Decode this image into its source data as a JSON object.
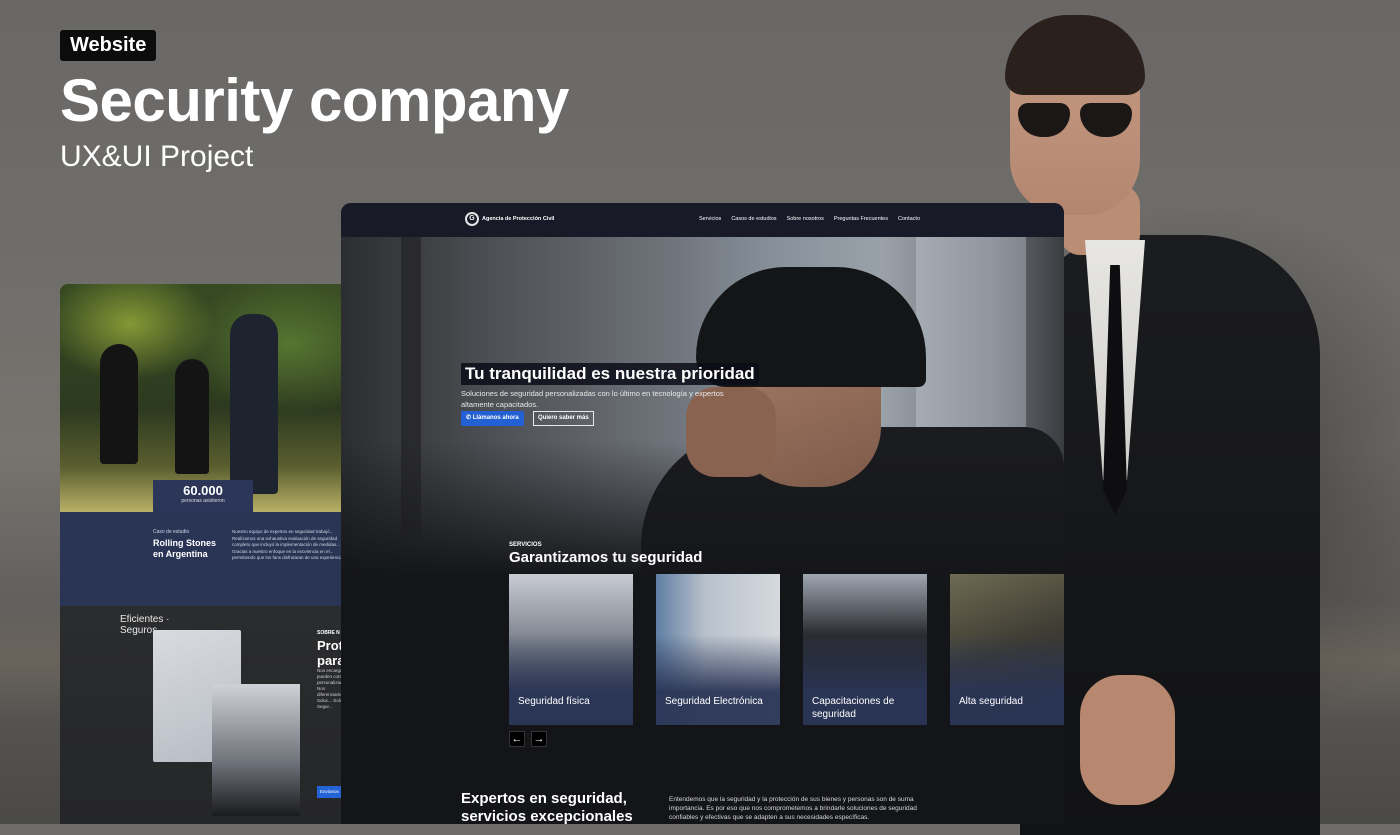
{
  "header": {
    "tag": "Website",
    "title": "Security company",
    "subtitle": "UX&UI Project"
  },
  "left_mockup": {
    "stat_number": "60.000",
    "stat_label": "personas asistieron",
    "case_small": "Caso de estudio",
    "case_title": "Rolling Stones en Argentina",
    "case_text": "Nuestro equipo de expertos en seguridad trabajó... Realizamos una exhaustiva evaluación de seguridad completo que incluyó la implementación de medidas... Gracias a nuestro enfoque en la excelencia en el... permitiendo que los fans disfrutaran de una experiencia...",
    "circle_text": "Eficientes · Seguros",
    "section_label": "SOBRE N",
    "section_title": "Prot para",
    "section_text": "Nos encargamos... pueden contar... personalizadas... Nos diferenciamos... Soluc... Soluc... Segur...",
    "button": "Envíanos"
  },
  "site": {
    "logo_mark": "G",
    "logo_text": "Agencia de Protección Civil",
    "nav": [
      "Servicios",
      "Casos de estudios",
      "Sobre nosotros",
      "Preguntas Frecuentes",
      "Contacto"
    ],
    "hero_title": "Tu tranquilidad es nuestra prioridad",
    "hero_sub": "Soluciones de seguridad personalizadas con lo último en tecnología y expertos altamente capacitados.",
    "hero_btn_primary": "Llámanos ahora",
    "hero_btn_secondary": "Quiero saber más",
    "services_label": "SERVICIOS",
    "services_title": "Garantizamos tu seguridad",
    "cards": [
      "Seguridad física",
      "Seguridad Electrónica",
      "Capacitaciones de seguridad",
      "Alta seguridad"
    ],
    "arrow_prev": "←",
    "arrow_next": "→",
    "experts_title": "Expertos en seguridad, servicios excepcionales",
    "experts_text": "Entendemos que la seguridad y la protección de sus bienes y personas son de suma importancia. Es por eso que nos comprometemos a brindarle soluciones de seguridad confiables y efectivas que se adapten a sus necesidades específicas."
  },
  "colors": {
    "navy": "#2a3556",
    "nav_bg": "#181a28",
    "primary_button": "#2360d3",
    "background": "#6d6c6a"
  }
}
